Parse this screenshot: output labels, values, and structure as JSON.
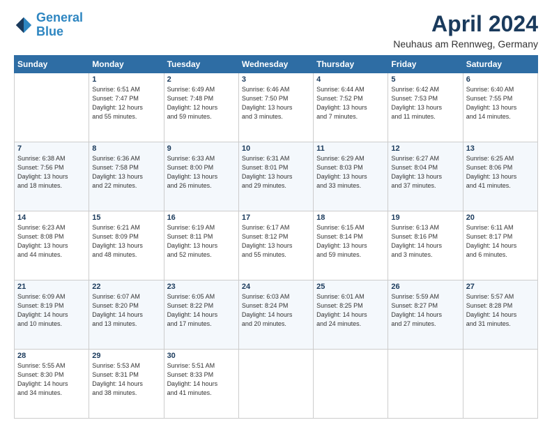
{
  "logo": {
    "line1": "General",
    "line2": "Blue"
  },
  "header": {
    "month": "April 2024",
    "location": "Neuhaus am Rennweg, Germany"
  },
  "days_of_week": [
    "Sunday",
    "Monday",
    "Tuesday",
    "Wednesday",
    "Thursday",
    "Friday",
    "Saturday"
  ],
  "weeks": [
    [
      {
        "day": "",
        "info": ""
      },
      {
        "day": "1",
        "info": "Sunrise: 6:51 AM\nSunset: 7:47 PM\nDaylight: 12 hours\nand 55 minutes."
      },
      {
        "day": "2",
        "info": "Sunrise: 6:49 AM\nSunset: 7:48 PM\nDaylight: 12 hours\nand 59 minutes."
      },
      {
        "day": "3",
        "info": "Sunrise: 6:46 AM\nSunset: 7:50 PM\nDaylight: 13 hours\nand 3 minutes."
      },
      {
        "day": "4",
        "info": "Sunrise: 6:44 AM\nSunset: 7:52 PM\nDaylight: 13 hours\nand 7 minutes."
      },
      {
        "day": "5",
        "info": "Sunrise: 6:42 AM\nSunset: 7:53 PM\nDaylight: 13 hours\nand 11 minutes."
      },
      {
        "day": "6",
        "info": "Sunrise: 6:40 AM\nSunset: 7:55 PM\nDaylight: 13 hours\nand 14 minutes."
      }
    ],
    [
      {
        "day": "7",
        "info": "Sunrise: 6:38 AM\nSunset: 7:56 PM\nDaylight: 13 hours\nand 18 minutes."
      },
      {
        "day": "8",
        "info": "Sunrise: 6:36 AM\nSunset: 7:58 PM\nDaylight: 13 hours\nand 22 minutes."
      },
      {
        "day": "9",
        "info": "Sunrise: 6:33 AM\nSunset: 8:00 PM\nDaylight: 13 hours\nand 26 minutes."
      },
      {
        "day": "10",
        "info": "Sunrise: 6:31 AM\nSunset: 8:01 PM\nDaylight: 13 hours\nand 29 minutes."
      },
      {
        "day": "11",
        "info": "Sunrise: 6:29 AM\nSunset: 8:03 PM\nDaylight: 13 hours\nand 33 minutes."
      },
      {
        "day": "12",
        "info": "Sunrise: 6:27 AM\nSunset: 8:04 PM\nDaylight: 13 hours\nand 37 minutes."
      },
      {
        "day": "13",
        "info": "Sunrise: 6:25 AM\nSunset: 8:06 PM\nDaylight: 13 hours\nand 41 minutes."
      }
    ],
    [
      {
        "day": "14",
        "info": "Sunrise: 6:23 AM\nSunset: 8:08 PM\nDaylight: 13 hours\nand 44 minutes."
      },
      {
        "day": "15",
        "info": "Sunrise: 6:21 AM\nSunset: 8:09 PM\nDaylight: 13 hours\nand 48 minutes."
      },
      {
        "day": "16",
        "info": "Sunrise: 6:19 AM\nSunset: 8:11 PM\nDaylight: 13 hours\nand 52 minutes."
      },
      {
        "day": "17",
        "info": "Sunrise: 6:17 AM\nSunset: 8:12 PM\nDaylight: 13 hours\nand 55 minutes."
      },
      {
        "day": "18",
        "info": "Sunrise: 6:15 AM\nSunset: 8:14 PM\nDaylight: 13 hours\nand 59 minutes."
      },
      {
        "day": "19",
        "info": "Sunrise: 6:13 AM\nSunset: 8:16 PM\nDaylight: 14 hours\nand 3 minutes."
      },
      {
        "day": "20",
        "info": "Sunrise: 6:11 AM\nSunset: 8:17 PM\nDaylight: 14 hours\nand 6 minutes."
      }
    ],
    [
      {
        "day": "21",
        "info": "Sunrise: 6:09 AM\nSunset: 8:19 PM\nDaylight: 14 hours\nand 10 minutes."
      },
      {
        "day": "22",
        "info": "Sunrise: 6:07 AM\nSunset: 8:20 PM\nDaylight: 14 hours\nand 13 minutes."
      },
      {
        "day": "23",
        "info": "Sunrise: 6:05 AM\nSunset: 8:22 PM\nDaylight: 14 hours\nand 17 minutes."
      },
      {
        "day": "24",
        "info": "Sunrise: 6:03 AM\nSunset: 8:24 PM\nDaylight: 14 hours\nand 20 minutes."
      },
      {
        "day": "25",
        "info": "Sunrise: 6:01 AM\nSunset: 8:25 PM\nDaylight: 14 hours\nand 24 minutes."
      },
      {
        "day": "26",
        "info": "Sunrise: 5:59 AM\nSunset: 8:27 PM\nDaylight: 14 hours\nand 27 minutes."
      },
      {
        "day": "27",
        "info": "Sunrise: 5:57 AM\nSunset: 8:28 PM\nDaylight: 14 hours\nand 31 minutes."
      }
    ],
    [
      {
        "day": "28",
        "info": "Sunrise: 5:55 AM\nSunset: 8:30 PM\nDaylight: 14 hours\nand 34 minutes."
      },
      {
        "day": "29",
        "info": "Sunrise: 5:53 AM\nSunset: 8:31 PM\nDaylight: 14 hours\nand 38 minutes."
      },
      {
        "day": "30",
        "info": "Sunrise: 5:51 AM\nSunset: 8:33 PM\nDaylight: 14 hours\nand 41 minutes."
      },
      {
        "day": "",
        "info": ""
      },
      {
        "day": "",
        "info": ""
      },
      {
        "day": "",
        "info": ""
      },
      {
        "day": "",
        "info": ""
      }
    ]
  ]
}
